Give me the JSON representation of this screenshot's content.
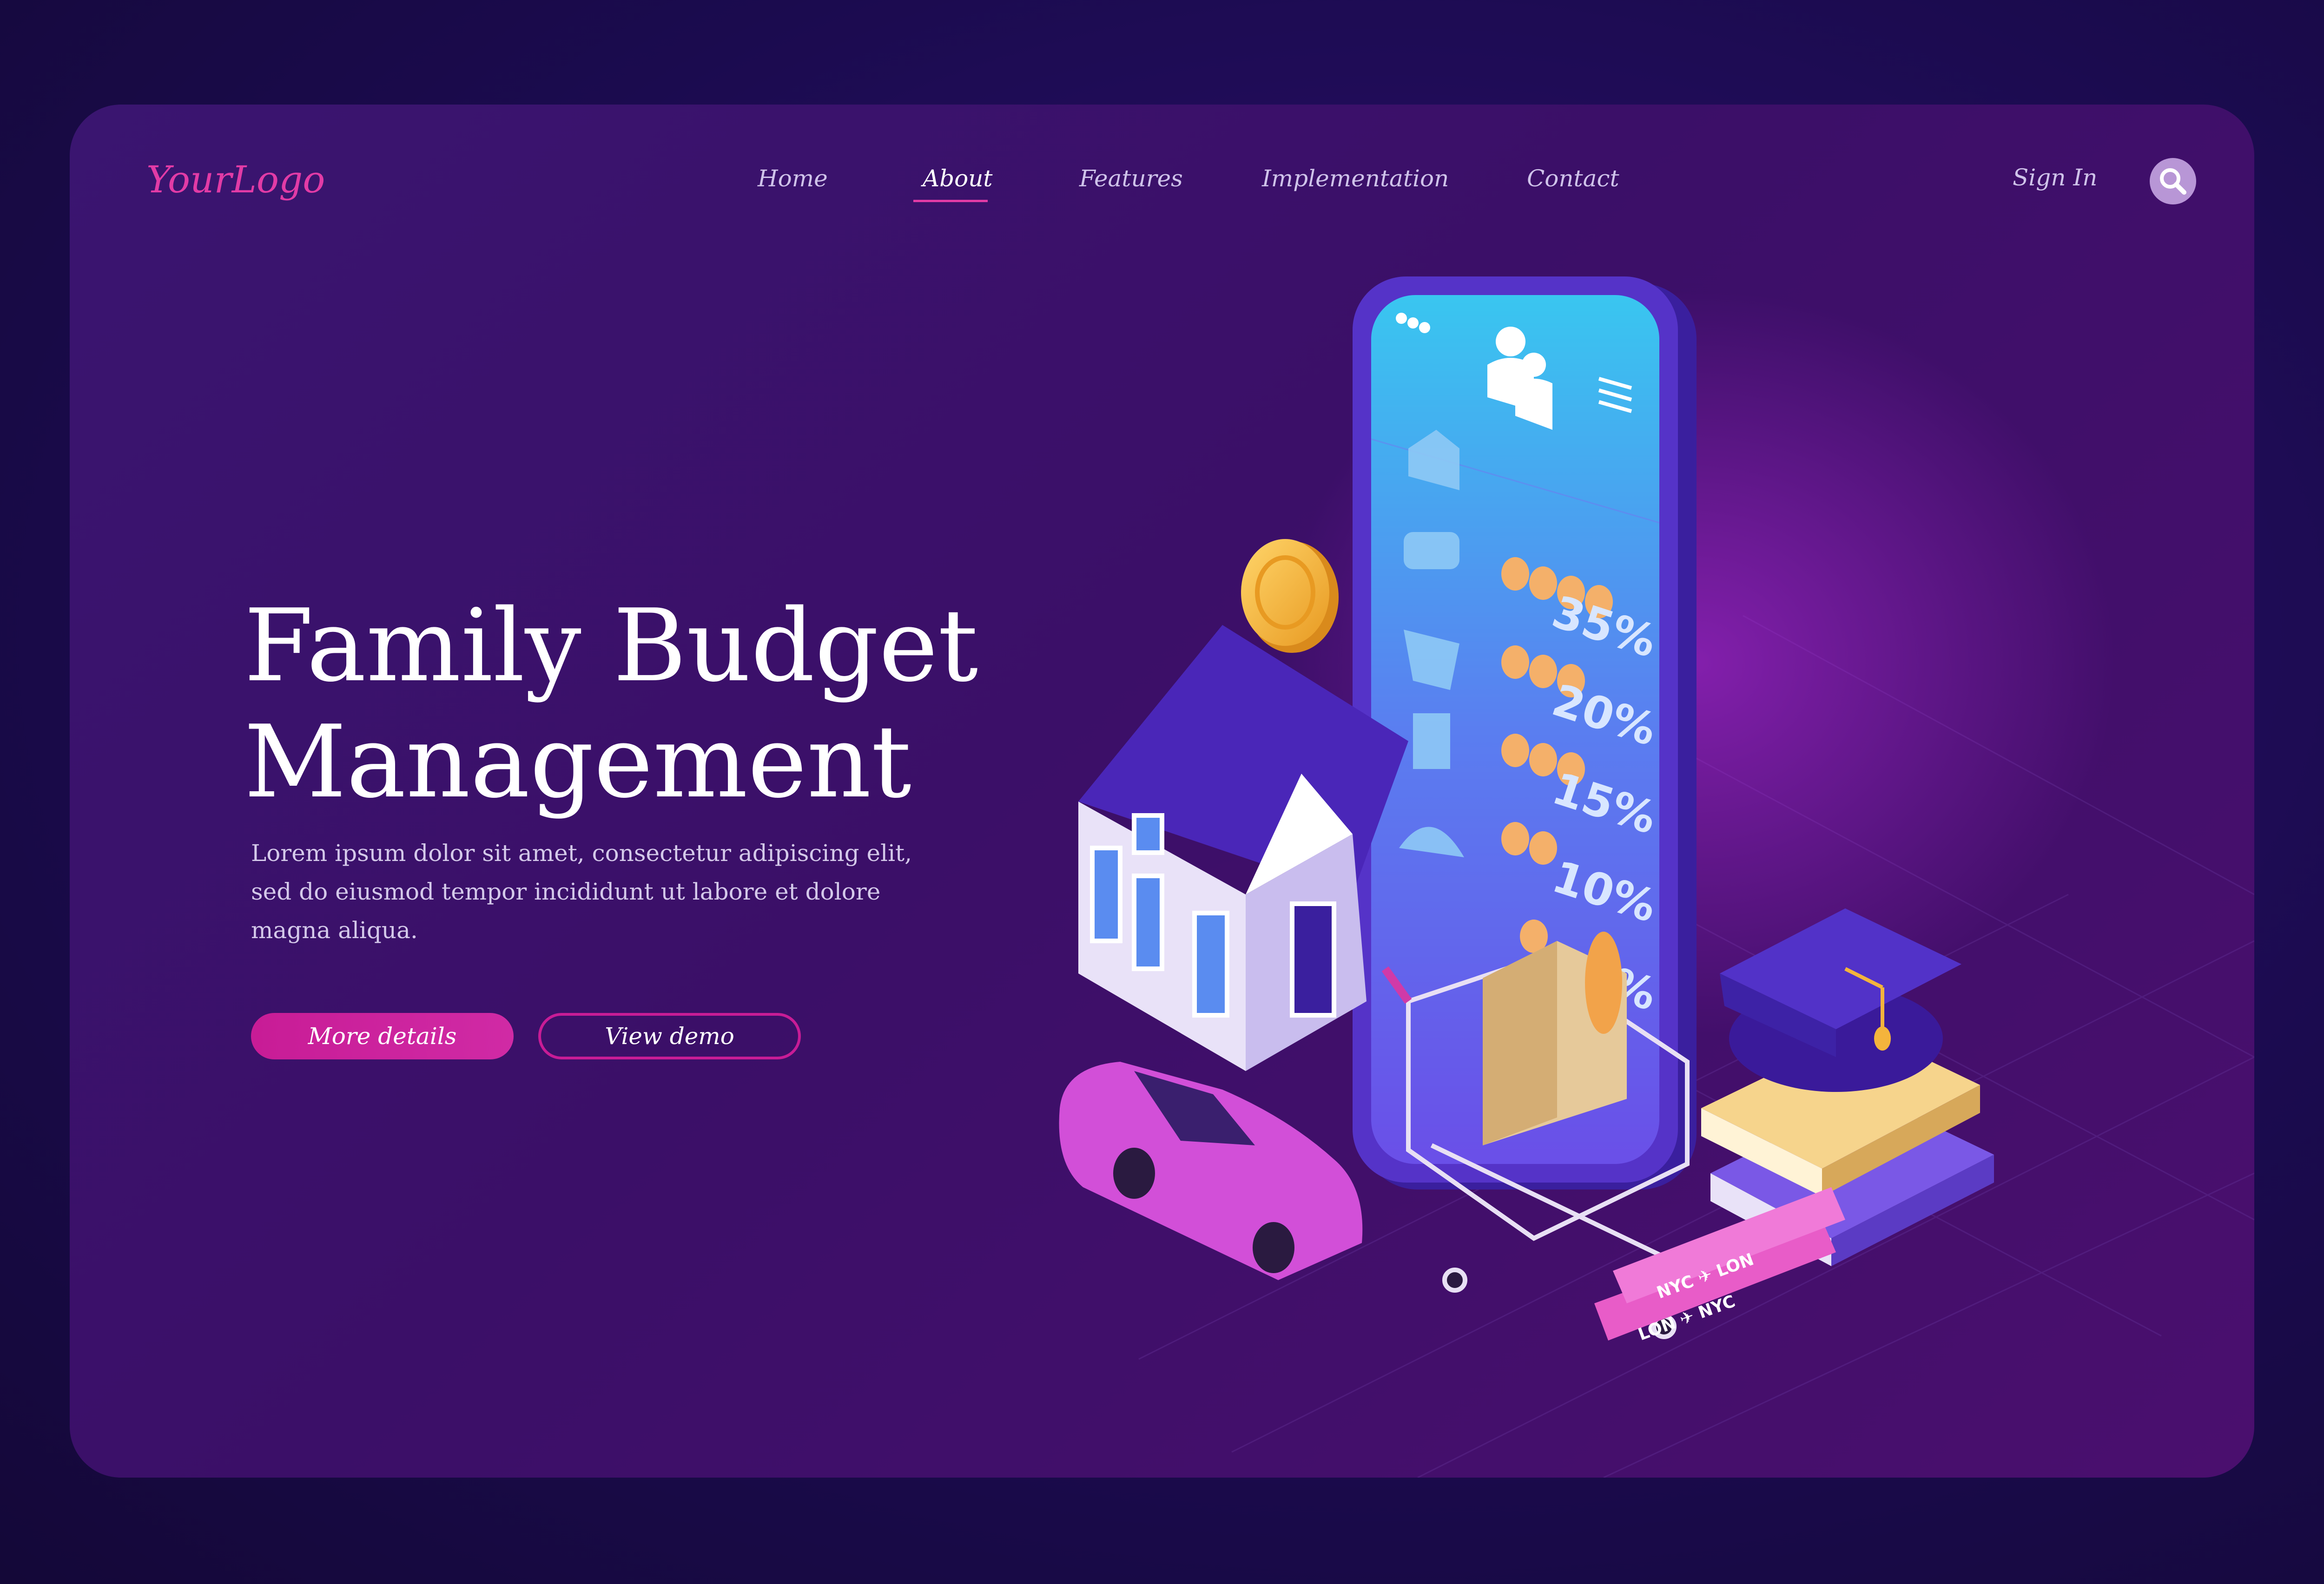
{
  "header": {
    "logo": "YourLogo",
    "nav": [
      {
        "label": "Home",
        "active": false
      },
      {
        "label": "About",
        "active": true
      },
      {
        "label": "Features",
        "active": false
      },
      {
        "label": "Implementation",
        "active": false
      },
      {
        "label": "Contact",
        "active": false
      }
    ],
    "sign_in": "Sign In"
  },
  "hero": {
    "title_line1": "Family Budget",
    "title_line2": "Management",
    "text": "Lorem ipsum dolor sit amet, consectetur adipiscing elit, sed do eiusmod tempor incididunt ut labore et dolore magna aliqua.",
    "primary_button": "More details",
    "secondary_button": "View demo"
  },
  "phone": {
    "percentages": [
      "35%",
      "20%",
      "15%",
      "10%",
      "5%"
    ]
  },
  "tickets": {
    "route": "NYC ✈ LON",
    "route_return": "LON ✈ NYC"
  },
  "colors": {
    "accent": "#e23ba6",
    "button": "#c81c96",
    "background": "#2a0c5e",
    "card": "#3b1168",
    "screen_top": "#39c6f0",
    "screen_bottom": "#6a4fe8",
    "coin": "#f4b43c"
  }
}
